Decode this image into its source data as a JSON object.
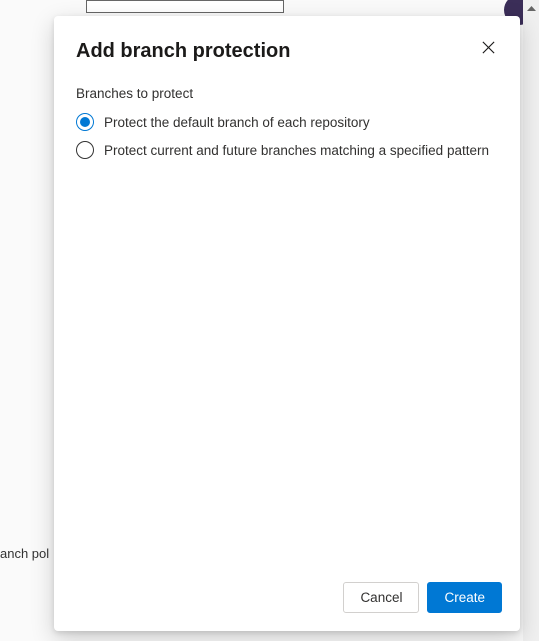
{
  "backdrop": {
    "truncated_text": "anch pol"
  },
  "dialog": {
    "title": "Add branch protection",
    "section_label": "Branches to protect",
    "options": [
      {
        "label": "Protect the default branch of each repository",
        "selected": true
      },
      {
        "label": "Protect current and future branches matching a specified pattern",
        "selected": false
      }
    ],
    "cancel_label": "Cancel",
    "create_label": "Create"
  }
}
